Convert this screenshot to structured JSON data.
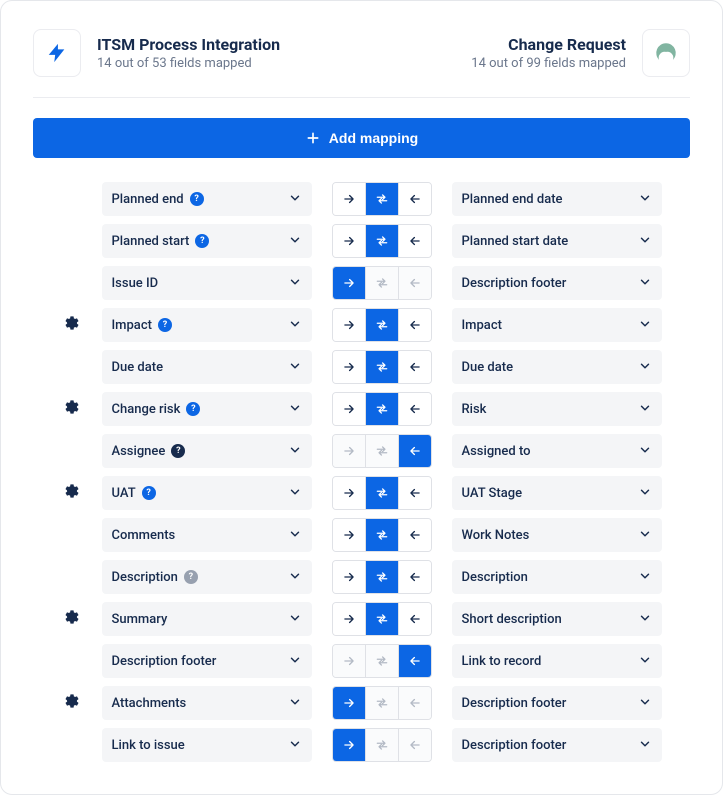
{
  "header": {
    "left": {
      "title": "ITSM Process Integration",
      "subtitle": "14 out of 53 fields mapped"
    },
    "right": {
      "title": "Change Request",
      "subtitle": "14 out of 99 fields mapped"
    }
  },
  "add_mapping_label": "Add mapping",
  "rows": [
    {
      "gear": false,
      "left": "Planned end",
      "help": "blue",
      "dir": "both",
      "right": "Planned end date"
    },
    {
      "gear": false,
      "left": "Planned start",
      "help": "blue",
      "dir": "both",
      "right": "Planned start date"
    },
    {
      "gear": false,
      "left": "Issue ID",
      "help": null,
      "dir": "right",
      "right": "Description footer"
    },
    {
      "gear": true,
      "left": "Impact",
      "help": "blue",
      "dir": "both",
      "right": "Impact"
    },
    {
      "gear": false,
      "left": "Due date",
      "help": null,
      "dir": "both",
      "right": "Due date"
    },
    {
      "gear": true,
      "left": "Change risk",
      "help": "blue",
      "dir": "both",
      "right": "Risk"
    },
    {
      "gear": false,
      "left": "Assignee",
      "help": "dark",
      "dir": "left",
      "right": "Assigned to"
    },
    {
      "gear": true,
      "left": "UAT",
      "help": "blue",
      "dir": "both",
      "right": "UAT Stage"
    },
    {
      "gear": false,
      "left": "Comments",
      "help": null,
      "dir": "both",
      "right": "Work Notes"
    },
    {
      "gear": false,
      "left": "Description",
      "help": "grey",
      "dir": "both",
      "right": "Description"
    },
    {
      "gear": true,
      "left": "Summary",
      "help": null,
      "dir": "both",
      "right": "Short description"
    },
    {
      "gear": false,
      "left": "Description footer",
      "help": null,
      "dir": "left",
      "right": "Link to record"
    },
    {
      "gear": true,
      "left": "Attachments",
      "help": null,
      "dir": "right",
      "right": "Description footer"
    },
    {
      "gear": false,
      "left": "Link to issue",
      "help": null,
      "dir": "right",
      "right": "Description footer"
    }
  ]
}
